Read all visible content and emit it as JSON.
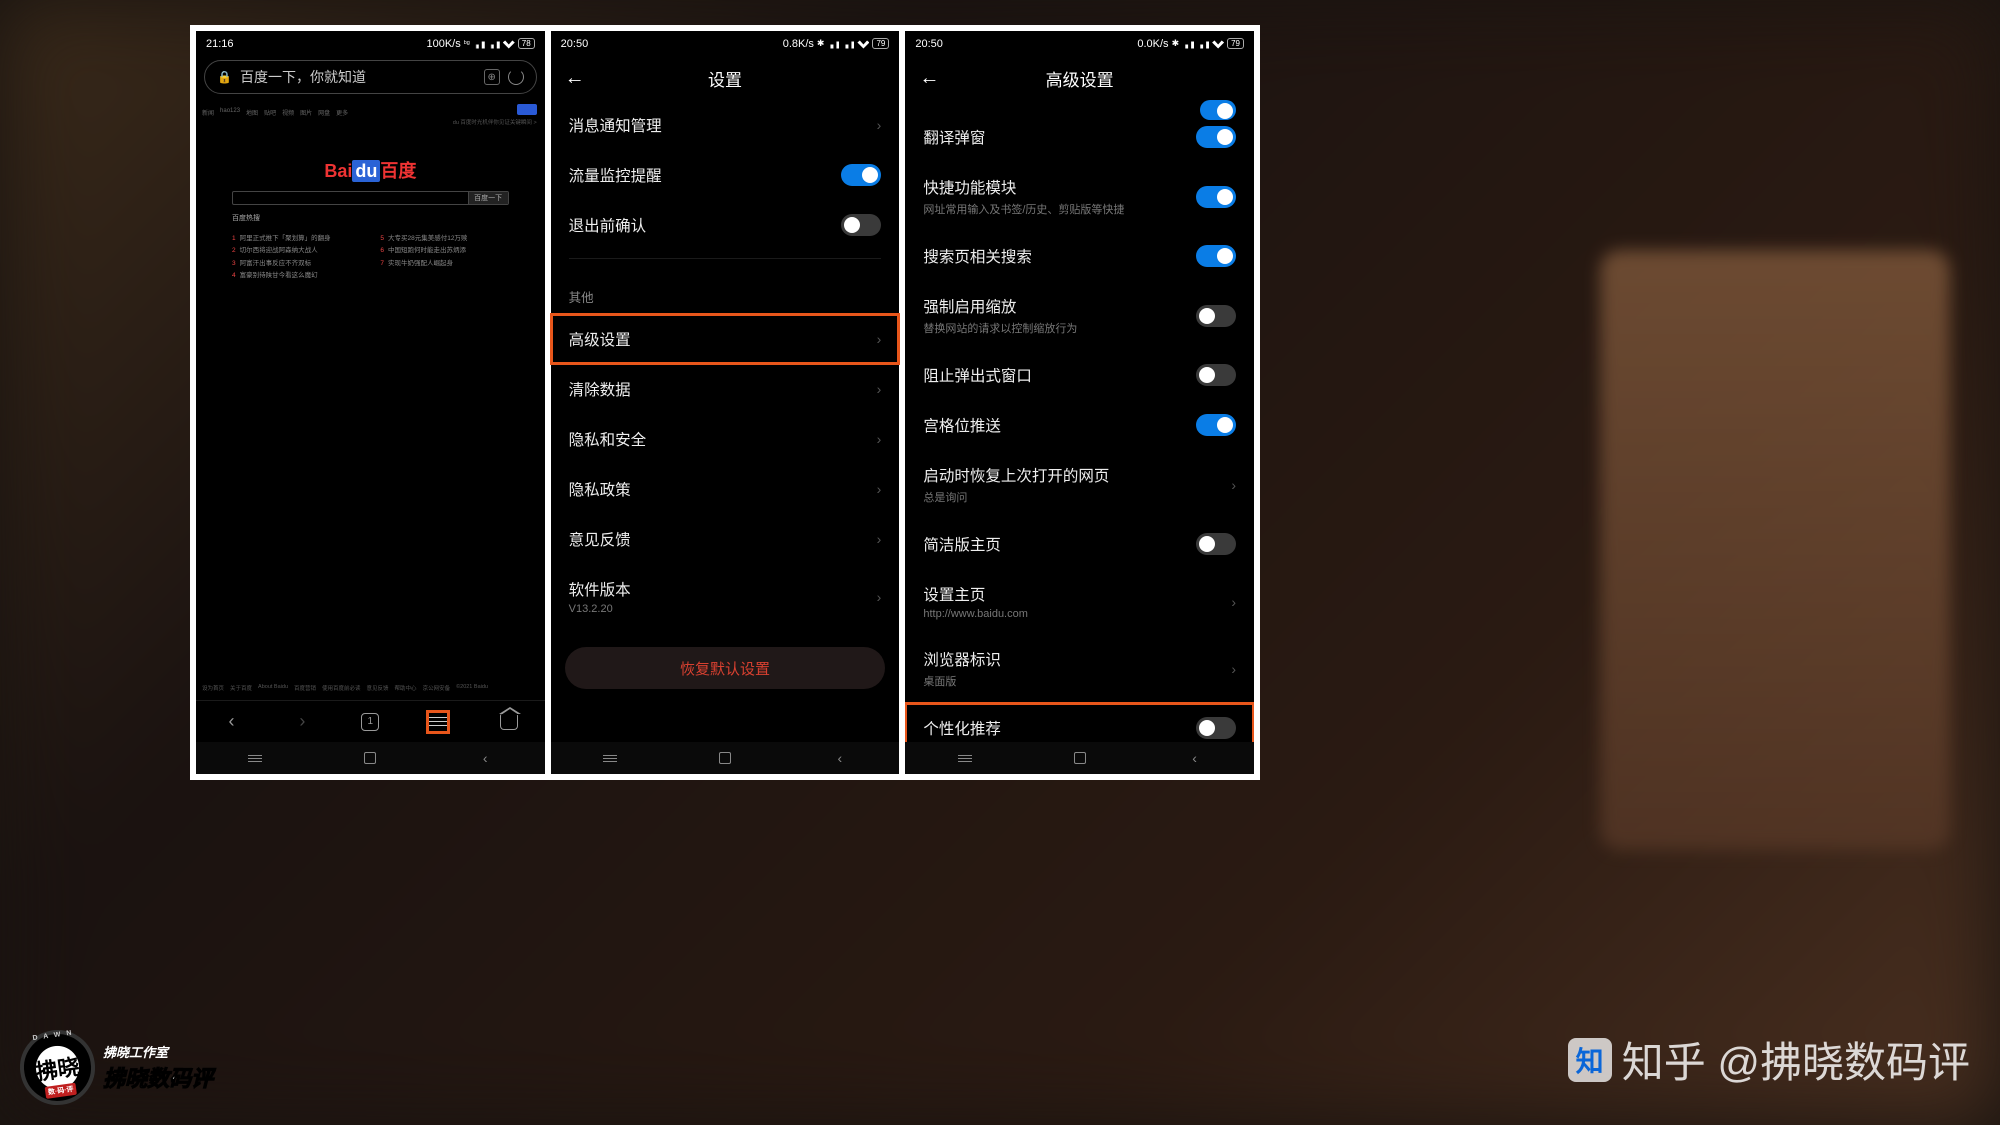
{
  "colors": {
    "accent": "#0a7de6",
    "highlight": "#e8561b",
    "danger": "#d84030"
  },
  "screen1": {
    "status": {
      "time": "21:16",
      "speed": "100K/s",
      "battery": "78"
    },
    "addressbar": "百度一下，你就知道",
    "baidu": {
      "topnav": [
        "新闻",
        "hao123",
        "地图",
        "贴吧",
        "视频",
        "图片",
        "网盘",
        "更多"
      ],
      "search_btn": "百度一下",
      "hot_label": "百度热搜",
      "hot_left": [
        "阿里正式推下「聚划算」的翻身",
        "切尔西将迎战阿森纳大战人",
        "阿富汗出事反应不齐双标",
        "富豪别待陕甘今看这么魔幻"
      ],
      "hot_right": [
        "大专买28元集美感付12万赎",
        "中国短跑何时能走出苏炳添",
        "实现牛奶强配人崛起身"
      ],
      "footer": [
        "设为首页",
        "关于百度",
        "About Baidu",
        "百度营销",
        "使用百度前必读",
        "意见反馈",
        "帮助中心",
        "京公网安备",
        "©2021 Baidu"
      ]
    },
    "bottomnav": {
      "pages": "1"
    }
  },
  "screen2": {
    "status": {
      "time": "20:50",
      "speed": "0.8K/s",
      "battery": "79"
    },
    "title": "设置",
    "rows": [
      {
        "label": "消息通知管理",
        "type": "chev"
      },
      {
        "label": "流量监控提醒",
        "type": "switch",
        "on": true
      },
      {
        "label": "退出前确认",
        "type": "switch",
        "on": false
      }
    ],
    "section": "其他",
    "rows2": [
      {
        "label": "高级设置",
        "type": "chev",
        "hl": true
      },
      {
        "label": "清除数据",
        "type": "chev"
      },
      {
        "label": "隐私和安全",
        "type": "chev"
      },
      {
        "label": "隐私政策",
        "type": "chev"
      },
      {
        "label": "意见反馈",
        "type": "chev"
      },
      {
        "label": "软件版本",
        "sub": "V13.2.20",
        "type": "chev"
      }
    ],
    "reset": "恢复默认设置"
  },
  "screen3": {
    "status": {
      "time": "20:50",
      "speed": "0.0K/s",
      "battery": "79"
    },
    "title": "高级设置",
    "rows": [
      {
        "label": "翻译弹窗",
        "type": "switch",
        "on": true
      },
      {
        "label": "快捷功能模块",
        "sub": "网址常用输入及书签/历史、剪贴版等快捷",
        "type": "switch",
        "on": true
      },
      {
        "label": "搜索页相关搜索",
        "type": "switch",
        "on": true
      },
      {
        "label": "强制启用缩放",
        "sub": "替换网站的请求以控制缩放行为",
        "type": "switch",
        "on": false
      },
      {
        "label": "阻止弹出式窗口",
        "type": "switch",
        "on": false
      },
      {
        "label": "宫格位推送",
        "type": "switch",
        "on": true
      },
      {
        "label": "启动时恢复上次打开的网页",
        "sub": "总是询问",
        "type": "chev"
      },
      {
        "label": "简洁版主页",
        "type": "switch",
        "on": false
      },
      {
        "label": "设置主页",
        "sub": "http://www.baidu.com",
        "type": "chev"
      },
      {
        "label": "浏览器标识",
        "sub": "桌面版",
        "type": "chev"
      },
      {
        "label": "个性化推荐",
        "type": "switch",
        "on": false,
        "hl": true
      }
    ]
  },
  "watermark": {
    "badge_main": "拂晓",
    "badge_sub": "数·码·评",
    "line1": "拂晓工作室",
    "line2": "拂晓数码评",
    "zhihu": "知乎 @拂晓数码评"
  }
}
